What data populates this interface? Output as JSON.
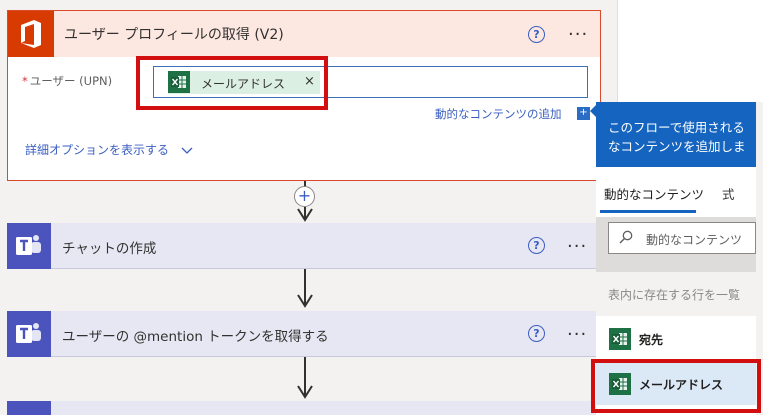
{
  "office_card": {
    "title": "ユーザー プロフィールの取得 (V2)",
    "help": "?",
    "more": "···",
    "field_required": "*",
    "field_label": "ユーザー (UPN)",
    "token_label": "メールアドレス",
    "token_remove": "×",
    "dynamic_link": "動的なコンテンツの追加",
    "dynamic_add": "+",
    "advanced_options": "詳細オプションを表示する"
  },
  "connector": {
    "plus": "+"
  },
  "teams_cards": [
    {
      "title": "チャットの作成",
      "help": "?",
      "more": "···"
    },
    {
      "title": "ユーザーの @mention トークンを取得する",
      "help": "?",
      "more": "···"
    }
  ],
  "panel": {
    "desc_line1": "このフローで使用される",
    "desc_line2": "なコンテンツを追加しま",
    "tab_dynamic": "動的なコンテンツ",
    "tab_expression": "式",
    "search_placeholder": "動的なコンテンツ",
    "section_header": "表内に存在する行を一覧",
    "items": [
      {
        "label": "宛先"
      },
      {
        "label": "メールアドレス"
      }
    ]
  },
  "colors": {
    "office_red": "#d83b01",
    "teams_purple": "#4b53bc",
    "accent_blue": "#1565c0",
    "excel_green": "#1e7145",
    "highlight_red": "#d20e0e"
  },
  "icons": [
    "office-icon",
    "excel-icon",
    "teams-icon",
    "help-icon",
    "more-icon",
    "search-icon",
    "chevron-down-icon",
    "plus-icon",
    "arrow-down-icon"
  ]
}
